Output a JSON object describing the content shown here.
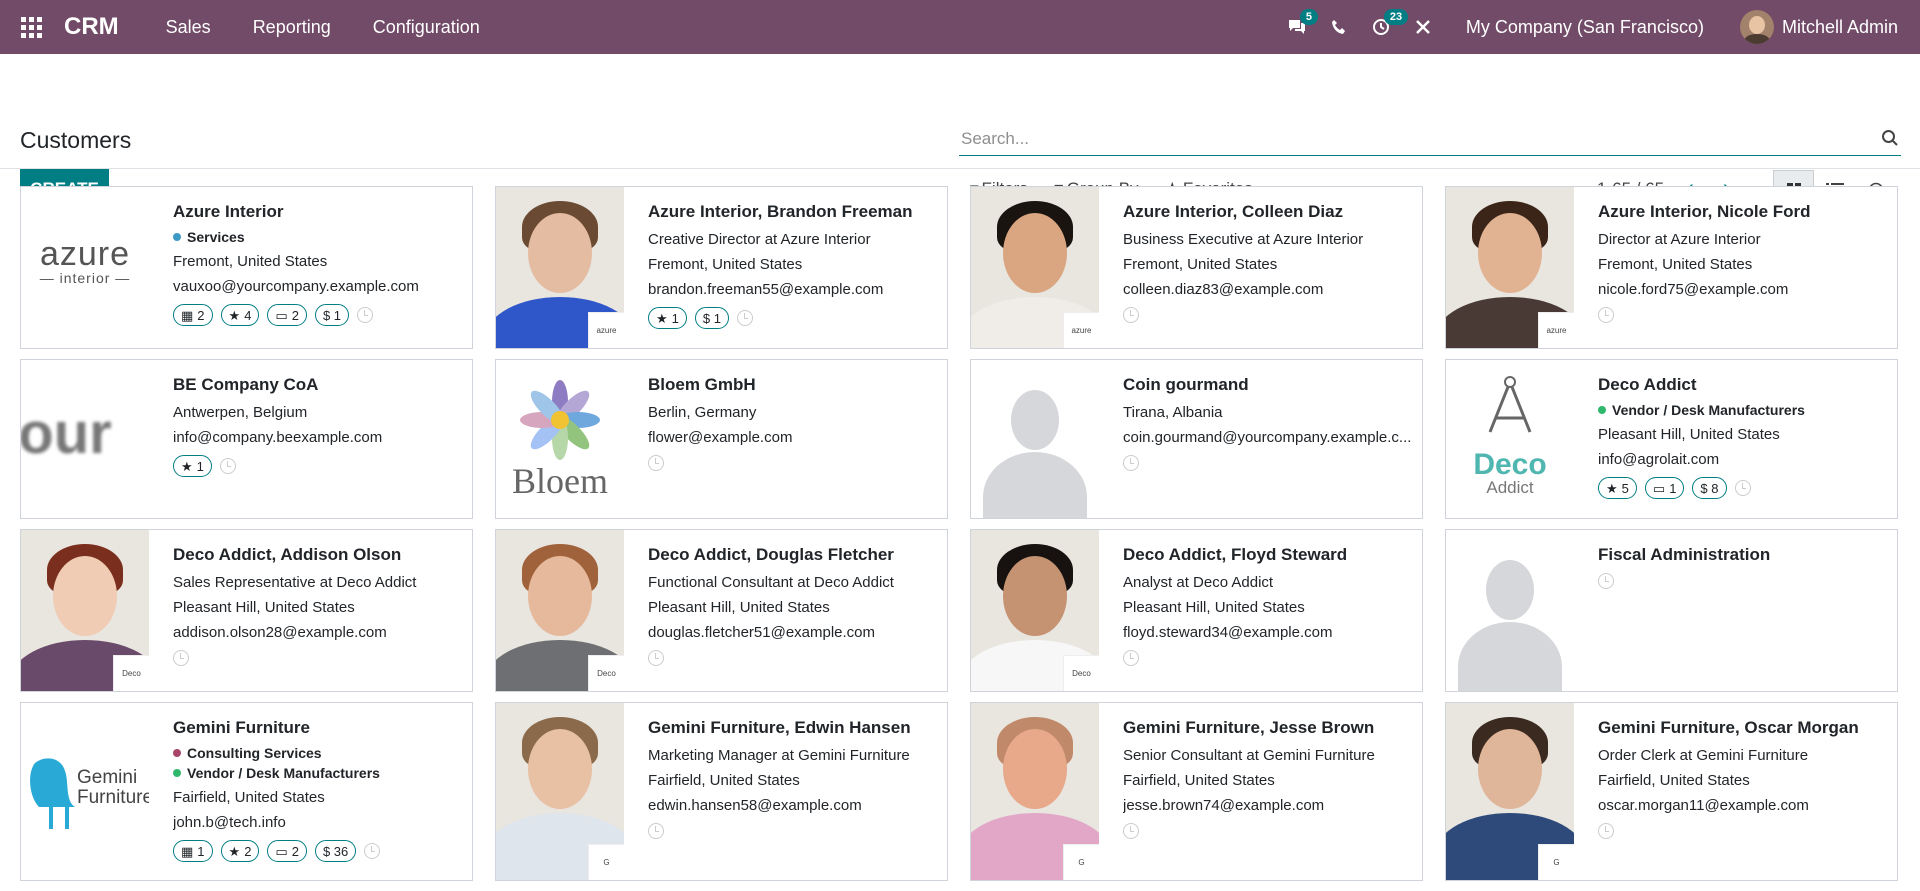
{
  "app": {
    "brand": "CRM",
    "menu": [
      "Sales",
      "Reporting",
      "Configuration"
    ]
  },
  "systray": {
    "messages_count": "5",
    "activities_count": "23",
    "company": "My Company (San Francisco)",
    "user": "Mitchell Admin"
  },
  "control_panel": {
    "title": "Customers",
    "create_label": "CREATE",
    "search_placeholder": "Search...",
    "filters_label": "Filters",
    "group_by_label": "Group By",
    "favorites_label": "Favorites",
    "pager": "1-65 / 65"
  },
  "customers": [
    {
      "name": "Azure Interior",
      "tags": [
        {
          "label": "Services",
          "color": "#3c9ac4"
        }
      ],
      "lines": [
        "Fremont, United States",
        "vauxoo@yourcompany.example.com"
      ],
      "pills": [
        {
          "icon": "calendar-icon",
          "value": "2"
        },
        {
          "icon": "star-icon",
          "value": "4"
        },
        {
          "icon": "card-icon",
          "value": "2"
        },
        {
          "icon": "dollar-icon",
          "value": "$ 1"
        }
      ],
      "image": "logo-azure"
    },
    {
      "name": "Azure Interior, Brandon Freeman",
      "tags": [],
      "lines": [
        "Creative Director at Azure Interior",
        "Fremont, United States",
        "brandon.freeman55@example.com"
      ],
      "pills": [
        {
          "icon": "star-icon",
          "value": "1"
        },
        {
          "icon": "dollar-icon",
          "value": "$ 1"
        }
      ],
      "image": "photo-man-blue"
    },
    {
      "name": "Azure Interior, Colleen Diaz",
      "tags": [],
      "lines": [
        "Business Executive at Azure Interior",
        "Fremont, United States",
        "colleen.diaz83@example.com"
      ],
      "pills": [],
      "image": "photo-woman-dark"
    },
    {
      "name": "Azure Interior, Nicole Ford",
      "tags": [],
      "lines": [
        "Director at Azure Interior",
        "Fremont, United States",
        "nicole.ford75@example.com"
      ],
      "pills": [],
      "image": "photo-woman-brown"
    },
    {
      "name": "BE Company CoA",
      "tags": [],
      "lines": [
        "Antwerpen, Belgium",
        "info@company.beexample.com"
      ],
      "pills": [
        {
          "icon": "star-icon",
          "value": "1"
        }
      ],
      "image": "logo-our"
    },
    {
      "name": "Bloem GmbH",
      "tags": [],
      "lines": [
        "Berlin, Germany",
        "flower@example.com"
      ],
      "pills": [],
      "image": "logo-bloem"
    },
    {
      "name": "Coin gourmand",
      "tags": [],
      "lines": [
        "Tirana, Albania",
        "coin.gourmand@yourcompany.example.c..."
      ],
      "pills": [],
      "image": "placeholder"
    },
    {
      "name": "Deco Addict",
      "tags": [
        {
          "label": "Vendor / Desk Manufacturers",
          "color": "#2fb86c"
        }
      ],
      "lines": [
        "Pleasant Hill, United States",
        "info@agrolait.com"
      ],
      "pills": [
        {
          "icon": "star-icon",
          "value": "5"
        },
        {
          "icon": "card-icon",
          "value": "1"
        },
        {
          "icon": "dollar-icon",
          "value": "$ 8"
        }
      ],
      "image": "logo-deco"
    },
    {
      "name": "Deco Addict, Addison Olson",
      "tags": [],
      "lines": [
        "Sales Representative at Deco Addict",
        "Pleasant Hill, United States",
        "addison.olson28@example.com"
      ],
      "pills": [],
      "image": "photo-woman-red"
    },
    {
      "name": "Deco Addict, Douglas Fletcher",
      "tags": [],
      "lines": [
        "Functional Consultant at Deco Addict",
        "Pleasant Hill, United States",
        "douglas.fletcher51@example.com"
      ],
      "pills": [],
      "image": "photo-man-beard"
    },
    {
      "name": "Deco Addict, Floyd Steward",
      "tags": [],
      "lines": [
        "Analyst at Deco Addict",
        "Pleasant Hill, United States",
        "floyd.steward34@example.com"
      ],
      "pills": [],
      "image": "photo-man-dark"
    },
    {
      "name": "Fiscal Administration",
      "tags": [],
      "lines": [],
      "pills": [],
      "image": "placeholder"
    },
    {
      "name": "Gemini Furniture",
      "tags": [
        {
          "label": "Consulting Services",
          "color": "#a8456b"
        },
        {
          "label": "Vendor / Desk Manufacturers",
          "color": "#2fb86c"
        }
      ],
      "lines": [
        "Fairfield, United States",
        "john.b@tech.info"
      ],
      "pills": [
        {
          "icon": "calendar-icon",
          "value": "1"
        },
        {
          "icon": "star-icon",
          "value": "2"
        },
        {
          "icon": "card-icon",
          "value": "2"
        },
        {
          "icon": "dollar-icon",
          "value": "$ 36"
        }
      ],
      "image": "logo-gemini"
    },
    {
      "name": "Gemini Furniture, Edwin Hansen",
      "tags": [],
      "lines": [
        "Marketing Manager at Gemini Furniture",
        "Fairfield, United States",
        "edwin.hansen58@example.com"
      ],
      "pills": [],
      "image": "photo-man-shirt"
    },
    {
      "name": "Gemini Furniture, Jesse Brown",
      "tags": [],
      "lines": [
        "Senior Consultant at Gemini Furniture",
        "Fairfield, United States",
        "jesse.brown74@example.com"
      ],
      "pills": [],
      "image": "photo-man-bald"
    },
    {
      "name": "Gemini Furniture, Oscar Morgan",
      "tags": [],
      "lines": [
        "Order Clerk at Gemini Furniture",
        "Fairfield, United States",
        "oscar.morgan11@example.com"
      ],
      "pills": [],
      "image": "photo-man-plaid"
    }
  ],
  "colors": {
    "navbar": "#714B67",
    "accent": "#017E84"
  }
}
